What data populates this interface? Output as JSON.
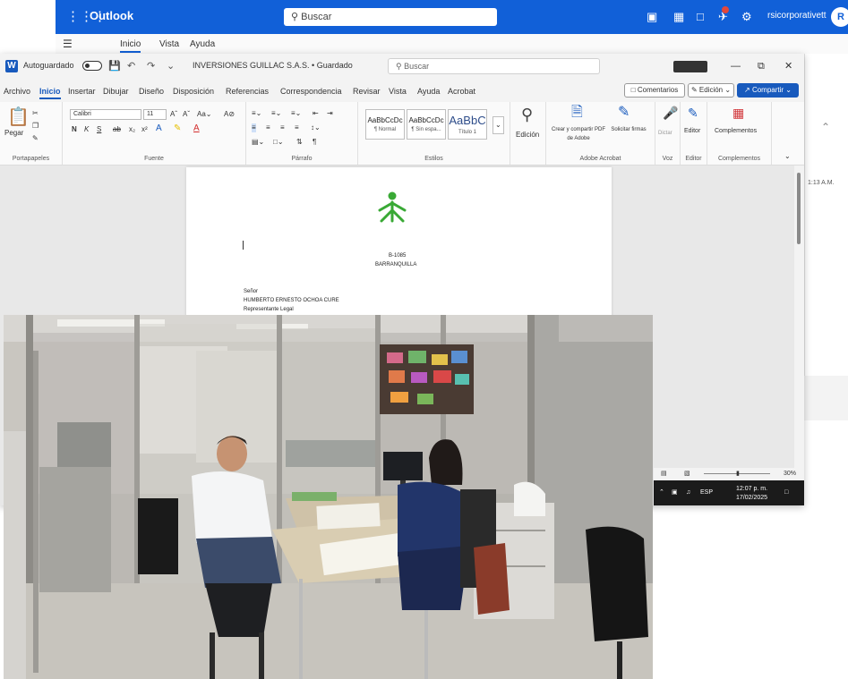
{
  "outlook": {
    "app_name": "Outlook",
    "search_placeholder": "Buscar",
    "user_name": "rsicorporativett",
    "avatar_initial": "R",
    "tabs": [
      "Inicio",
      "Vista",
      "Ayuda"
    ],
    "mail_time": "1:13 A.M."
  },
  "word": {
    "autosave_label": "Autoguardado",
    "doc_title": "INVERSIONES GUILLAC S.A.S. • Guardado",
    "search_placeholder": "Buscar",
    "menu_items": [
      "Archivo",
      "Inicio",
      "Insertar",
      "Dibujar",
      "Diseño",
      "Disposición",
      "Referencias",
      "Correspondencia",
      "Revisar",
      "Vista",
      "Ayuda",
      "Acrobat"
    ],
    "comments_label": "Comentarios",
    "editing_label": "Edición",
    "share_label": "Compartir",
    "ribbon": {
      "paste_label": "Pegar",
      "clipboard_label": "Portapapeles",
      "font_name": "Calibri",
      "font_size": "11",
      "font_label": "Fuente",
      "paragraph_label": "Párrafo",
      "styles": [
        {
          "sample": "AaBbCcDc",
          "name": "¶ Normal"
        },
        {
          "sample": "AaBbCcDc",
          "name": "¶ Sin espa..."
        },
        {
          "sample": "AaBbC",
          "name": "Título 1"
        }
      ],
      "styles_label": "Estilos",
      "editing_btn": "Edición",
      "adobe_create": "Crear y compartir PDF de Adobe",
      "adobe_sign": "Solicitar firmas",
      "adobe_label": "Adobe Acrobat",
      "voice_btn": "Dictar",
      "voice_label": "Voz",
      "editor_btn": "Editor",
      "editor_label": "Editor",
      "addins_btn": "Complementos",
      "addins_label": "Complementos"
    },
    "document": {
      "org_line1": "B-1085",
      "org_line2": "BARRANQUILLA",
      "salutation": "Señor",
      "recipient": "HUMBERTO ERNESTO OCHOA CURE",
      "recipient_title": "Representante Legal"
    },
    "status_zoom": "30%",
    "taskbar_time": "12:07 p. m.",
    "taskbar_date": "17/02/2025"
  },
  "colors": {
    "outlook_blue": "#1160d8",
    "word_blue": "#185abd",
    "logo_green": "#39a935"
  }
}
